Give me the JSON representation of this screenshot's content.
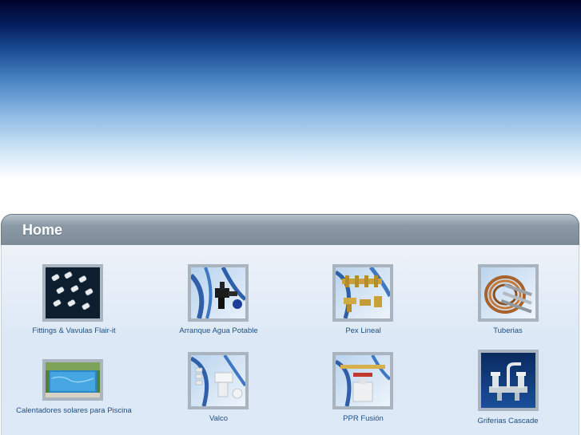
{
  "page": {
    "title": "Home"
  },
  "products": [
    {
      "label": "Fittings & Vavulas Flair-it",
      "icon": "white-fittings-icon"
    },
    {
      "label": "Arranque Agua Potable",
      "icon": "black-valve-icon"
    },
    {
      "label": "Pex Lineal",
      "icon": "brass-manifold-icon"
    },
    {
      "label": "Tuberias",
      "icon": "copper-pipe-icon"
    },
    {
      "label": "Calentadores solares para Piscina",
      "icon": "swimming-pool-icon"
    },
    {
      "label": "Valco",
      "icon": "pvc-fittings-icon"
    },
    {
      "label": "PPR Fusión",
      "icon": "ppr-valve-icon"
    },
    {
      "label": "Griferias Cascade",
      "icon": "chrome-faucet-icon"
    }
  ]
}
